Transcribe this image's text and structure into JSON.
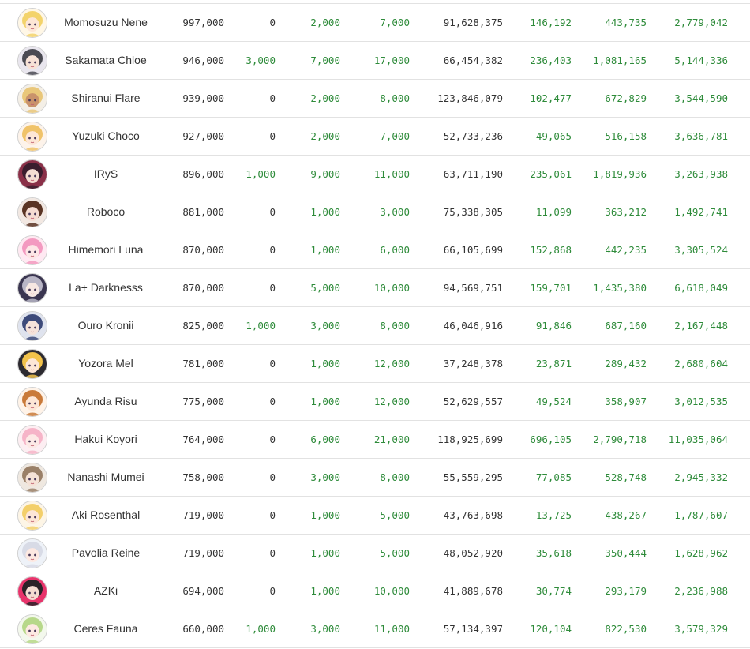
{
  "colors": {
    "positive": "#2e8b3a",
    "neutral": "#333333",
    "divider": "#e2e2e2"
  },
  "rows": [
    {
      "name": "Momosuzu Nene",
      "subs": "997,000",
      "d1": "0",
      "d7": "2,000",
      "d30": "7,000",
      "views": "91,628,375",
      "v1": "146,192",
      "v7": "443,735",
      "v30": "2,779,042",
      "avatar": {
        "icon": "avatar-momosuzu-nene",
        "hair": "#f3d36b",
        "skin": "#fde6d6",
        "bg": "#fff7e6"
      }
    },
    {
      "name": "Sakamata Chloe",
      "subs": "946,000",
      "d1": "3,000",
      "d7": "7,000",
      "d30": "17,000",
      "views": "66,454,382",
      "v1": "236,403",
      "v7": "1,081,165",
      "v30": "5,144,336",
      "avatar": {
        "icon": "avatar-sakamata-chloe",
        "hair": "#4a4a52",
        "skin": "#f7e2d6",
        "bg": "#e9e6ee"
      }
    },
    {
      "name": "Shiranui Flare",
      "subs": "939,000",
      "d1": "0",
      "d7": "2,000",
      "d30": "8,000",
      "views": "123,846,079",
      "v1": "102,477",
      "v7": "672,829",
      "v30": "3,544,590",
      "avatar": {
        "icon": "avatar-shiranui-flare",
        "hair": "#e9c77a",
        "skin": "#c9926b",
        "bg": "#f4efe6"
      }
    },
    {
      "name": "Yuzuki Choco",
      "subs": "927,000",
      "d1": "0",
      "d7": "2,000",
      "d30": "7,000",
      "views": "52,733,236",
      "v1": "49,065",
      "v7": "516,158",
      "v30": "3,636,781",
      "avatar": {
        "icon": "avatar-yuzuki-choco",
        "hair": "#f0c36a",
        "skin": "#fde6d6",
        "bg": "#fdf3ea"
      }
    },
    {
      "name": "IRyS",
      "subs": "896,000",
      "d1": "1,000",
      "d7": "9,000",
      "d30": "11,000",
      "views": "63,711,190",
      "v1": "235,061",
      "v7": "1,819,936",
      "v30": "3,263,938",
      "avatar": {
        "icon": "avatar-irys",
        "hair": "#3a1e2e",
        "skin": "#f5dcd2",
        "bg": "#8a3048"
      }
    },
    {
      "name": "Roboco",
      "subs": "881,000",
      "d1": "0",
      "d7": "1,000",
      "d30": "3,000",
      "views": "75,338,305",
      "v1": "11,099",
      "v7": "363,212",
      "v30": "1,492,741",
      "avatar": {
        "icon": "avatar-roboco",
        "hair": "#5a3424",
        "skin": "#f5dcd2",
        "bg": "#f2e8e2"
      }
    },
    {
      "name": "Himemori Luna",
      "subs": "870,000",
      "d1": "0",
      "d7": "1,000",
      "d30": "6,000",
      "views": "66,105,699",
      "v1": "152,868",
      "v7": "442,235",
      "v30": "3,305,524",
      "avatar": {
        "icon": "avatar-himemori-luna",
        "hair": "#f39ac0",
        "skin": "#fde6e6",
        "bg": "#ffe9f2"
      }
    },
    {
      "name": "La+ Darknesss",
      "subs": "870,000",
      "d1": "0",
      "d7": "5,000",
      "d30": "10,000",
      "views": "94,569,751",
      "v1": "159,701",
      "v7": "1,435,380",
      "v30": "6,618,049",
      "avatar": {
        "icon": "avatar-la-darknesss",
        "hair": "#b9b6c6",
        "skin": "#f7e8e2",
        "bg": "#3a3550"
      }
    },
    {
      "name": "Ouro Kronii",
      "subs": "825,000",
      "d1": "1,000",
      "d7": "3,000",
      "d30": "8,000",
      "views": "46,046,916",
      "v1": "91,846",
      "v7": "687,160",
      "v30": "2,167,448",
      "avatar": {
        "icon": "avatar-ouro-kronii",
        "hair": "#3d4a7a",
        "skin": "#f5e2da",
        "bg": "#dfe3ee"
      }
    },
    {
      "name": "Yozora Mel",
      "subs": "781,000",
      "d1": "0",
      "d7": "1,000",
      "d30": "12,000",
      "views": "37,248,378",
      "v1": "23,871",
      "v7": "289,432",
      "v30": "2,680,604",
      "avatar": {
        "icon": "avatar-yozora-mel",
        "hair": "#f2c24a",
        "skin": "#fde6d6",
        "bg": "#2c2a30"
      }
    },
    {
      "name": "Ayunda Risu",
      "subs": "775,000",
      "d1": "0",
      "d7": "1,000",
      "d30": "12,000",
      "views": "52,629,557",
      "v1": "49,524",
      "v7": "358,907",
      "v30": "3,012,535",
      "avatar": {
        "icon": "avatar-ayunda-risu",
        "hair": "#c97a3a",
        "skin": "#fde6d6",
        "bg": "#fff3e8"
      }
    },
    {
      "name": "Hakui Koyori",
      "subs": "764,000",
      "d1": "0",
      "d7": "6,000",
      "d30": "21,000",
      "views": "118,925,699",
      "v1": "696,105",
      "v7": "2,790,718",
      "v30": "11,035,064",
      "avatar": {
        "icon": "avatar-hakui-koyori",
        "hair": "#f6b4c8",
        "skin": "#fde9e6",
        "bg": "#fdeef2"
      }
    },
    {
      "name": "Nanashi Mumei",
      "subs": "758,000",
      "d1": "0",
      "d7": "3,000",
      "d30": "8,000",
      "views": "55,559,295",
      "v1": "77,085",
      "v7": "528,748",
      "v30": "2,945,332",
      "avatar": {
        "icon": "avatar-nanashi-mumei",
        "hair": "#9a8068",
        "skin": "#f5e2d6",
        "bg": "#efe8e0"
      }
    },
    {
      "name": "Aki Rosenthal",
      "subs": "719,000",
      "d1": "0",
      "d7": "1,000",
      "d30": "5,000",
      "views": "43,763,698",
      "v1": "13,725",
      "v7": "438,267",
      "v30": "1,787,607",
      "avatar": {
        "icon": "avatar-aki-rosenthal",
        "hair": "#f3cf6a",
        "skin": "#fde6d6",
        "bg": "#fdf5e6"
      }
    },
    {
      "name": "Pavolia Reine",
      "subs": "719,000",
      "d1": "0",
      "d7": "1,000",
      "d30": "5,000",
      "views": "48,052,920",
      "v1": "35,618",
      "v7": "350,444",
      "v30": "1,628,962",
      "avatar": {
        "icon": "avatar-pavolia-reine",
        "hair": "#d8dbe6",
        "skin": "#fde9e2",
        "bg": "#eef2f8"
      }
    },
    {
      "name": "AZKi",
      "subs": "694,000",
      "d1": "0",
      "d7": "1,000",
      "d30": "10,000",
      "views": "41,889,678",
      "v1": "30,774",
      "v7": "293,179",
      "v30": "2,236,988",
      "avatar": {
        "icon": "avatar-azki",
        "hair": "#2a2228",
        "skin": "#f5dcd2",
        "bg": "#e8336b"
      }
    },
    {
      "name": "Ceres Fauna",
      "subs": "660,000",
      "d1": "1,000",
      "d7": "3,000",
      "d30": "11,000",
      "views": "57,134,397",
      "v1": "120,104",
      "v7": "822,530",
      "v30": "3,579,329",
      "avatar": {
        "icon": "avatar-ceres-fauna",
        "hair": "#b7d88a",
        "skin": "#fde9e2",
        "bg": "#f3f8ec"
      }
    }
  ]
}
